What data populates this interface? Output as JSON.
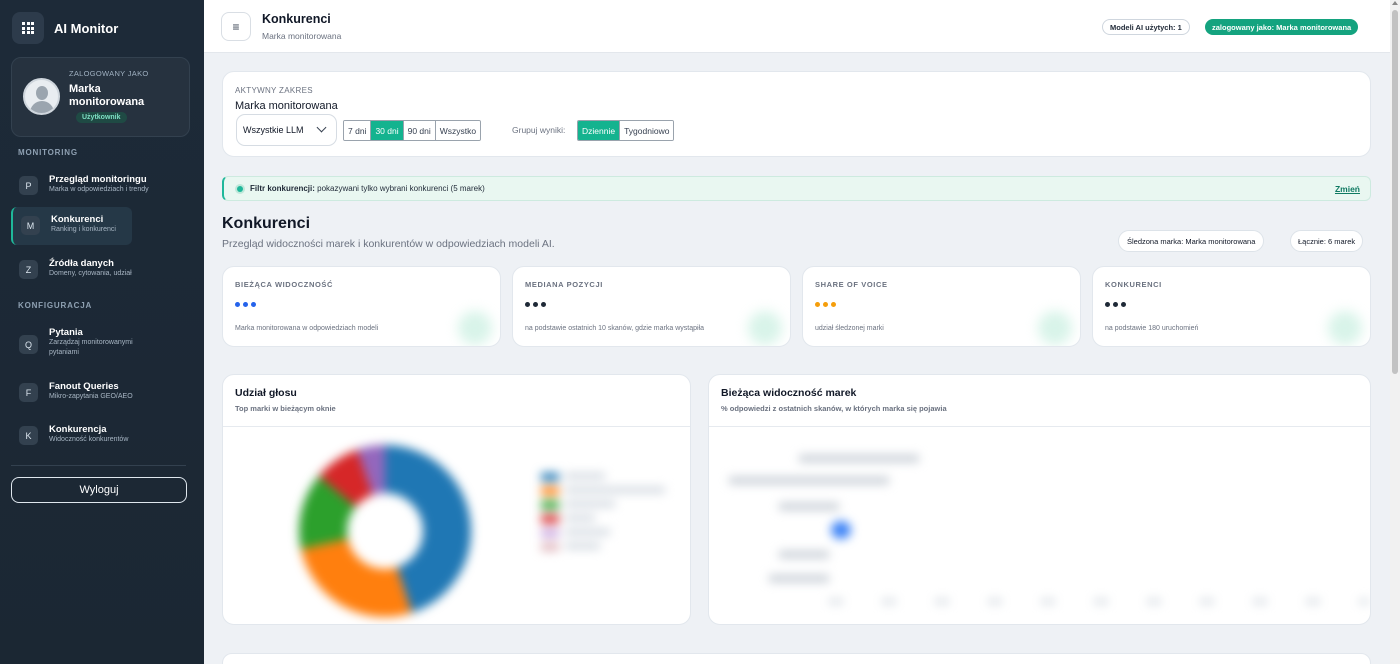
{
  "app": {
    "name": "AI Monitor"
  },
  "user": {
    "role_label": "ZALOGOWANY JAKO",
    "name": "Marka monitorowana",
    "badge": "Użytkownik"
  },
  "sidebar": {
    "sections": [
      {
        "title": "MONITORING"
      },
      {
        "title": "KONFIGURACJA"
      }
    ],
    "items": [
      {
        "letter": "P",
        "title": "Przegląd monitoringu",
        "sub": "Marka w odpowiedziach i trendy"
      },
      {
        "letter": "M",
        "title": "Konkurenci",
        "sub": "Ranking i konkurenci",
        "active": true
      },
      {
        "letter": "Z",
        "title": "Źródła danych",
        "sub": "Domeny, cytowania, udział"
      },
      {
        "letter": "Q",
        "title": "Pytania",
        "sub": "Zarządzaj monitorowanymi pytaniami"
      },
      {
        "letter": "F",
        "title": "Fanout Queries",
        "sub": "Mikro-zapytania GEO/AEO"
      },
      {
        "letter": "K",
        "title": "Konkurencja",
        "sub": "Widoczność konkurentów"
      }
    ],
    "logout": "Wyloguj"
  },
  "topbar": {
    "menu_icon": "≡",
    "title": "Konkurenci",
    "subtitle": "Marka monitorowana",
    "models_pill": "Modeli AI użytych: 1",
    "logged_pill": "zalogowany jako: Marka monitorowana"
  },
  "range": {
    "label": "AKTYWNY ZAKRES",
    "value": "Marka monitorowana",
    "llm_select": "Wszystkie LLM",
    "periods": [
      "7 dni",
      "30 dni",
      "90 dni",
      "Wszystko"
    ],
    "active_period": "30 dni",
    "group_label": "Grupuj wyniki:",
    "group_options": [
      "Dziennie",
      "Tygodniowo"
    ],
    "active_group": "Dziennie"
  },
  "filter": {
    "label": "Filtr konkurencji:",
    "text": " pokazywani tylko wybrani konkurenci (5 marek)",
    "change": "Zmień"
  },
  "section": {
    "title": "Konkurenci",
    "subtitle": "Przegląd widoczności marek i konkurentów w odpowiedziach modeli AI.",
    "tracked_pill": "Śledzona marka: Marka monitorowana",
    "total_pill": "Łącznie: 6 marek"
  },
  "kpis": [
    {
      "label": "BIEŻĄCA WIDOCZNOŚĆ",
      "value": "•••",
      "dot_color": "#2563eb",
      "foot": "Marka monitorowana w odpowiedziach modeli"
    },
    {
      "label": "MEDIANA POZYCJI",
      "value": "•••",
      "dot_color": "#1f2937",
      "foot": "na podstawie ostatnich 10 skanów, gdzie marka wystąpiła"
    },
    {
      "label": "SHARE OF VOICE",
      "value": "•••",
      "dot_color": "#f59e0b",
      "foot": "udział śledzonej marki"
    },
    {
      "label": "KONKURENCI",
      "value": "•••",
      "dot_color": "#1f2937",
      "foot": "na podstawie 180 uruchomień"
    }
  ],
  "charts": {
    "share": {
      "title": "Udział głosu",
      "subtitle": "Top marki w bieżącym oknie"
    },
    "visibility": {
      "title": "Bieżąca widoczność marek",
      "subtitle": "% odpowiedzi z ostatnich skanów, w których marka się pojawia"
    }
  },
  "colors": {
    "accent": "#14b38f",
    "sidebar_bg": "#1d2a38",
    "donut": [
      "#1f77b4",
      "#ff7f0e",
      "#2ca02c",
      "#d62728",
      "#9467bd"
    ]
  }
}
